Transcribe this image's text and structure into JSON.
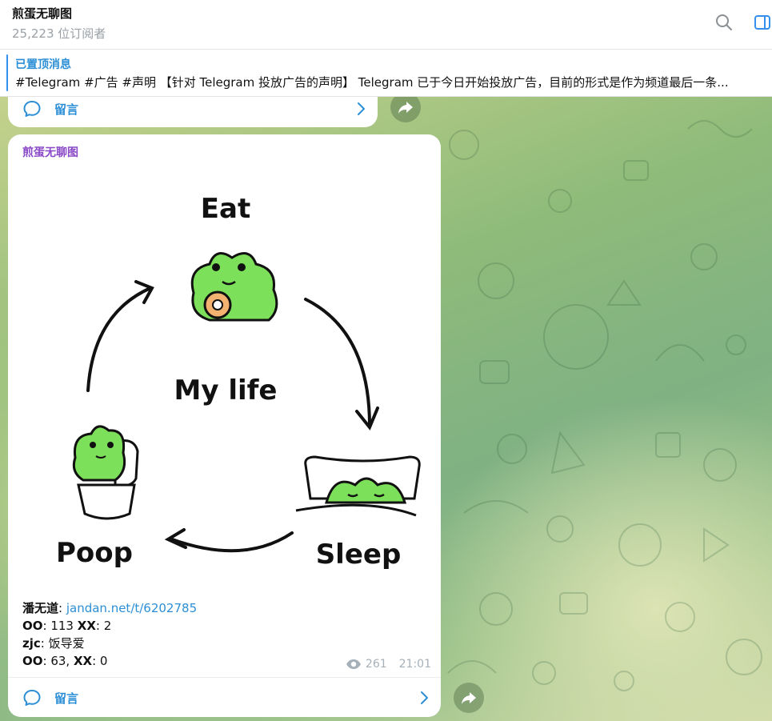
{
  "header": {
    "title": "煎蛋无聊图",
    "subscribers": "25,223 位订阅者",
    "search_icon": "search-icon",
    "panel_icon": "side-panel-icon"
  },
  "pinned": {
    "label": "已置顶消息",
    "text": "#Telegram #广告 #声明 【针对 Telegram 投放广告的声明】 Telegram 已于今日开始投放广告，目前的形式是作为频道最后一条..."
  },
  "previous_message": {
    "comments_label": "留言"
  },
  "message": {
    "author": "煎蛋无聊图",
    "image": {
      "eat": "Eat",
      "center": "My life",
      "sleep": "Sleep",
      "poop": "Poop"
    },
    "caption": {
      "line1_name": "潘无道",
      "line1_sep": ": ",
      "line1_link": "jandan.net/t/6202785",
      "line2_oo_label": "OO",
      "line2_oo_value": ": 113 ",
      "line2_xx_label": "XX",
      "line2_xx_value": ": 2",
      "line3_name": "zjc",
      "line3_text": ": 饭导爱",
      "line4_oo_label": "OO",
      "line4_oo_value": ": 63, ",
      "line4_xx_label": "XX",
      "line4_xx_value": ": 0"
    },
    "views": "261",
    "time": "21:01",
    "comments_label": "留言"
  },
  "colors": {
    "accent": "#2c8fd6",
    "author": "#8a49c8",
    "frog": "#7de05a"
  }
}
